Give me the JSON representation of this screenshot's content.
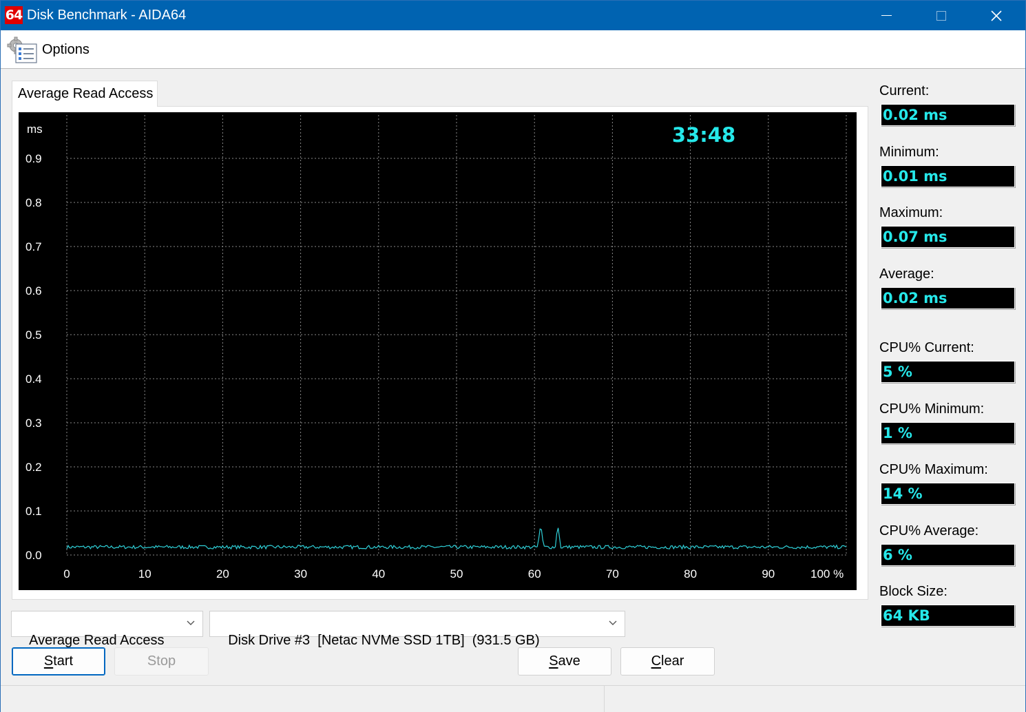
{
  "window": {
    "title": "Disk Benchmark - AIDA64",
    "icon_text": "64",
    "accent_color": "#0063b1",
    "icon_color": "#e00000"
  },
  "menu": {
    "options_label": "Options",
    "options_icon": "gear-checklist-icon"
  },
  "tab": {
    "label": "Average Read Access"
  },
  "graph": {
    "timer": "33:48",
    "timer_color": "#26e8ea",
    "line_color": "#2fd0d8"
  },
  "chart_data": {
    "type": "line",
    "title": "",
    "xlabel": "",
    "ylabel": "ms",
    "xlim": [
      0,
      100
    ],
    "ylim": [
      0,
      0.95
    ],
    "x_ticks": [
      "0",
      "10",
      "20",
      "30",
      "40",
      "50",
      "60",
      "70",
      "80",
      "90",
      "100 %"
    ],
    "y_ticks": [
      "0.0",
      "0.1",
      "0.2",
      "0.3",
      "0.4",
      "0.5",
      "0.6",
      "0.7",
      "0.8",
      "0.9"
    ],
    "grid": true,
    "baseline_value": 0.018,
    "series": [
      {
        "x": [
          0,
          5,
          10,
          15,
          20,
          25,
          30,
          35,
          40,
          45,
          50,
          55,
          60,
          60.4,
          60.8,
          61.2,
          62,
          62.6,
          63,
          63.4,
          64,
          70,
          75,
          80,
          85,
          90,
          95,
          100
        ],
        "values": [
          0.018,
          0.016,
          0.019,
          0.017,
          0.018,
          0.017,
          0.016,
          0.018,
          0.017,
          0.019,
          0.017,
          0.018,
          0.016,
          0.019,
          0.07,
          0.016,
          0.018,
          0.016,
          0.066,
          0.015,
          0.018,
          0.017,
          0.019,
          0.017,
          0.018,
          0.016,
          0.018,
          0.019
        ]
      }
    ]
  },
  "stats": {
    "current_label": "Current:",
    "current_value": "0.02 ms",
    "minimum_label": "Minimum:",
    "minimum_value": "0.01 ms",
    "maximum_label": "Maximum:",
    "maximum_value": "0.07 ms",
    "average_label": "Average:",
    "average_value": "0.02 ms",
    "cpu_current_label": "CPU% Current:",
    "cpu_current_value": "5 %",
    "cpu_minimum_label": "CPU% Minimum:",
    "cpu_minimum_value": "1 %",
    "cpu_maximum_label": "CPU% Maximum:",
    "cpu_maximum_value": "14 %",
    "cpu_average_label": "CPU% Average:",
    "cpu_average_value": "6 %",
    "block_size_label": "Block Size:",
    "block_size_value": "64 KB",
    "value_color": "#26e8ea"
  },
  "controls": {
    "test_select_value": "Average Read Access",
    "drive_select_value": "Disk Drive #3  [Netac NVMe SSD 1TB]  (931.5 GB)",
    "start_pre": "",
    "start_key": "S",
    "start_post": "tart",
    "stop_label": "Stop",
    "save_pre": "",
    "save_key": "S",
    "save_post": "ave",
    "clear_pre": "",
    "clear_key": "C",
    "clear_post": "lear"
  }
}
